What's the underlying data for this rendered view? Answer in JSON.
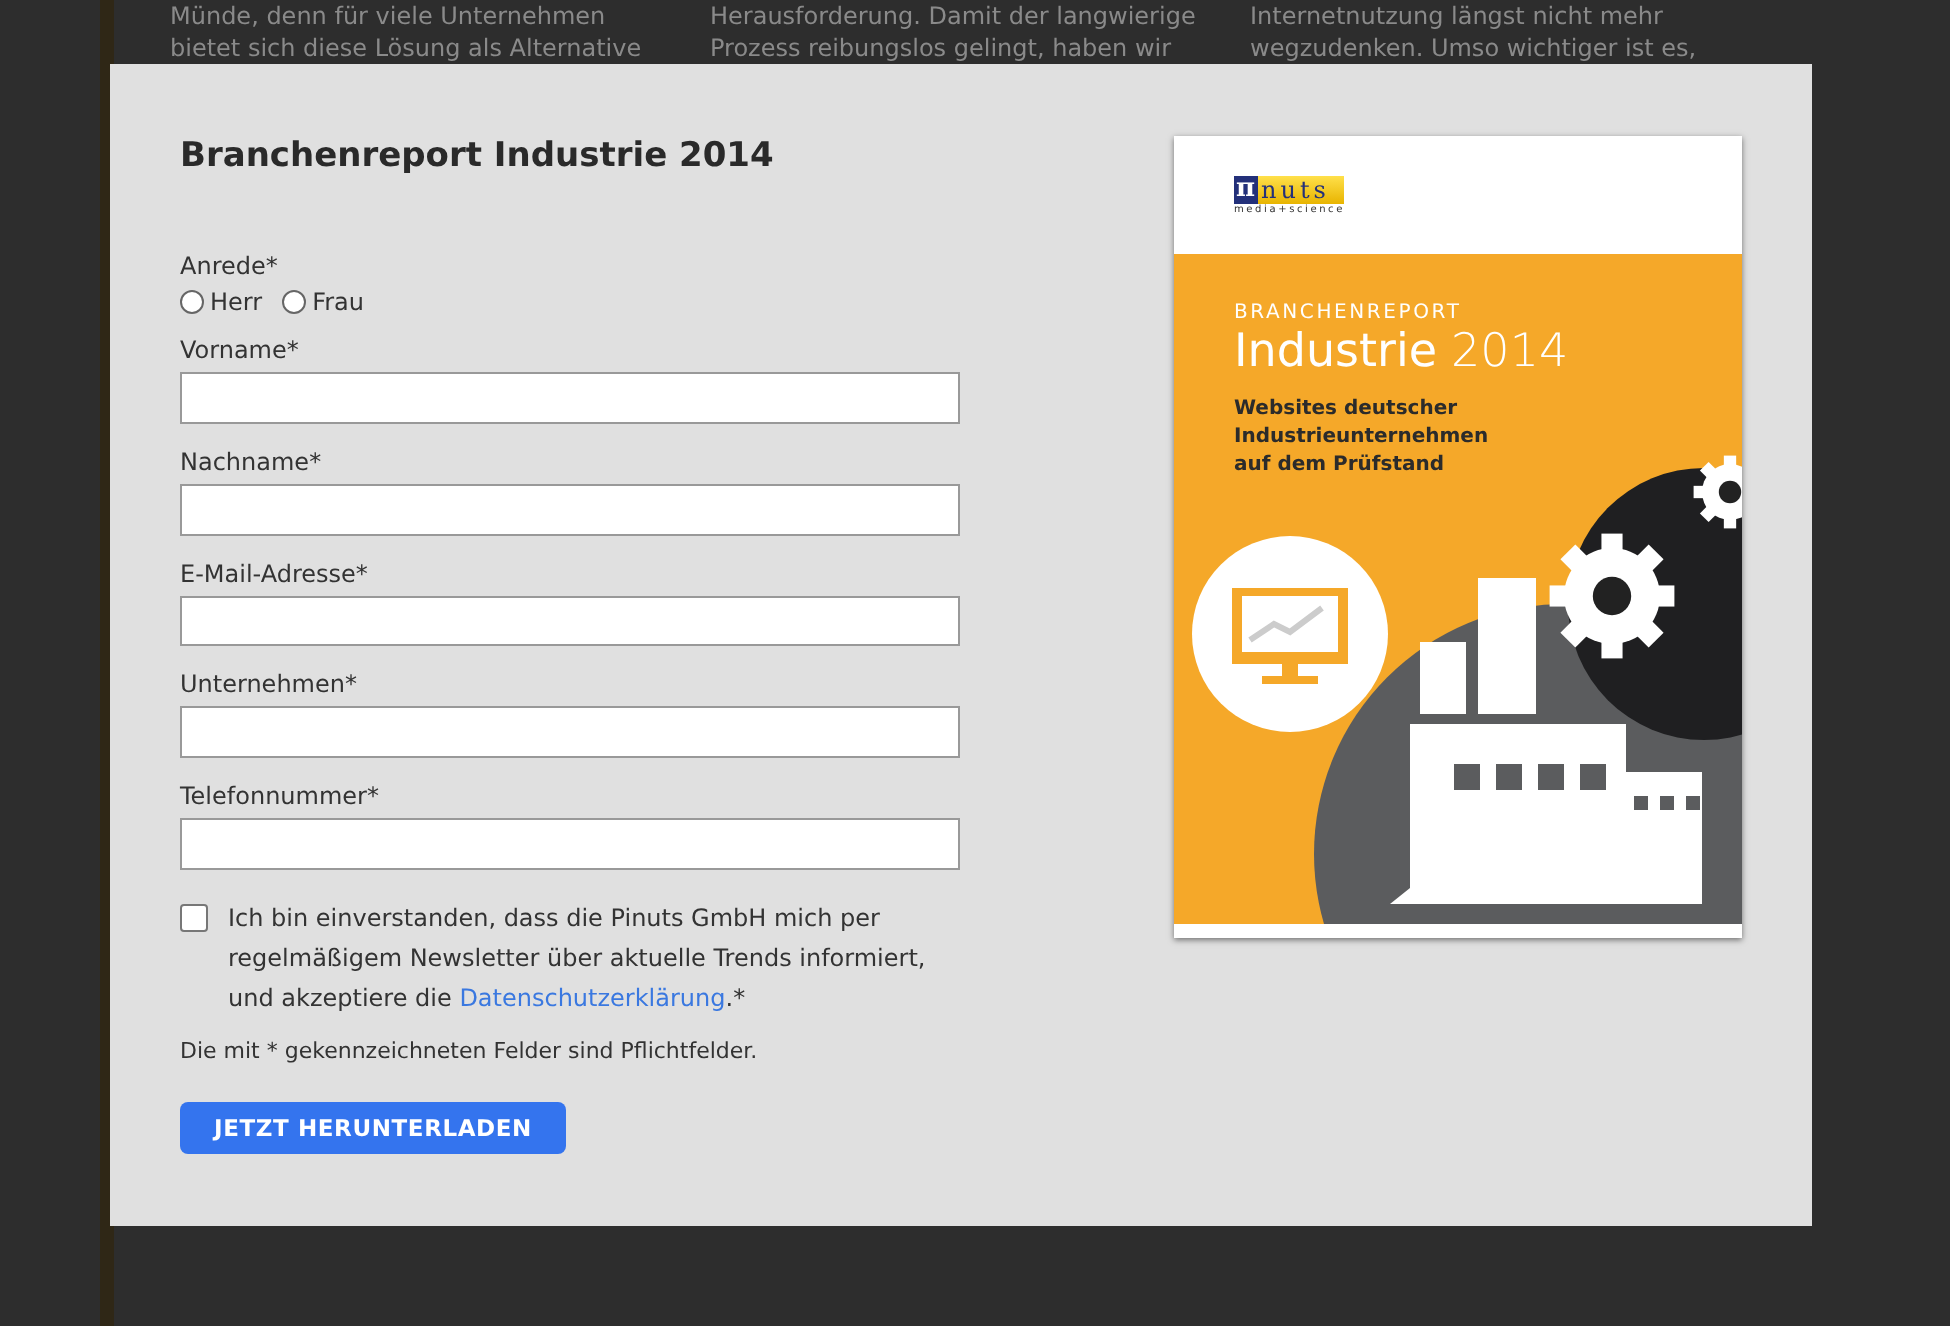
{
  "background_columns": [
    {
      "lines": [
        "Münde, denn für viele Unternehmen",
        "bietet sich diese Lösung als Alternative"
      ]
    },
    {
      "lines": [
        "Herausforderung. Damit der langwierige",
        "Prozess reibungslos gelingt, haben wir"
      ]
    },
    {
      "lines": [
        "Internetnutzung längst nicht mehr",
        "wegzudenken. Umso wichtiger ist es,"
      ]
    }
  ],
  "dialog": {
    "title": "Branchenreport Industrie 2014",
    "salutation": {
      "label": "Anrede*",
      "options": [
        {
          "label": "Herr",
          "selected": false
        },
        {
          "label": "Frau",
          "selected": false
        }
      ]
    },
    "fields": [
      {
        "label": "Vorname*"
      },
      {
        "label": "Nachname*"
      },
      {
        "label": "E-Mail-Adresse*"
      },
      {
        "label": "Unternehmen*"
      },
      {
        "label": "Telefonnummer*"
      }
    ],
    "consent": {
      "checked": false,
      "text": "Ich bin einverstanden, dass die Pinuts GmbH mich per regelmäßigem Newsletter über aktuelle Trends informiert, und akzeptiere die ",
      "link": "Datenschutzerklärung",
      "suffix": ".*"
    },
    "required_note": "Die mit * gekennzeichneten Felder sind Pflichtfelder.",
    "submit": "JETZT HERUNTERLADEN",
    "cover": {
      "logo_symbol": "π",
      "logo_word": "nuts",
      "logo_tagline": "media+science",
      "kicker": "BRANCHENREPORT",
      "title": "Industrie",
      "year": "2014",
      "subtitle": [
        "Websites deutscher",
        "Industrieunternehmen",
        "auf dem Prüfstand"
      ]
    }
  }
}
